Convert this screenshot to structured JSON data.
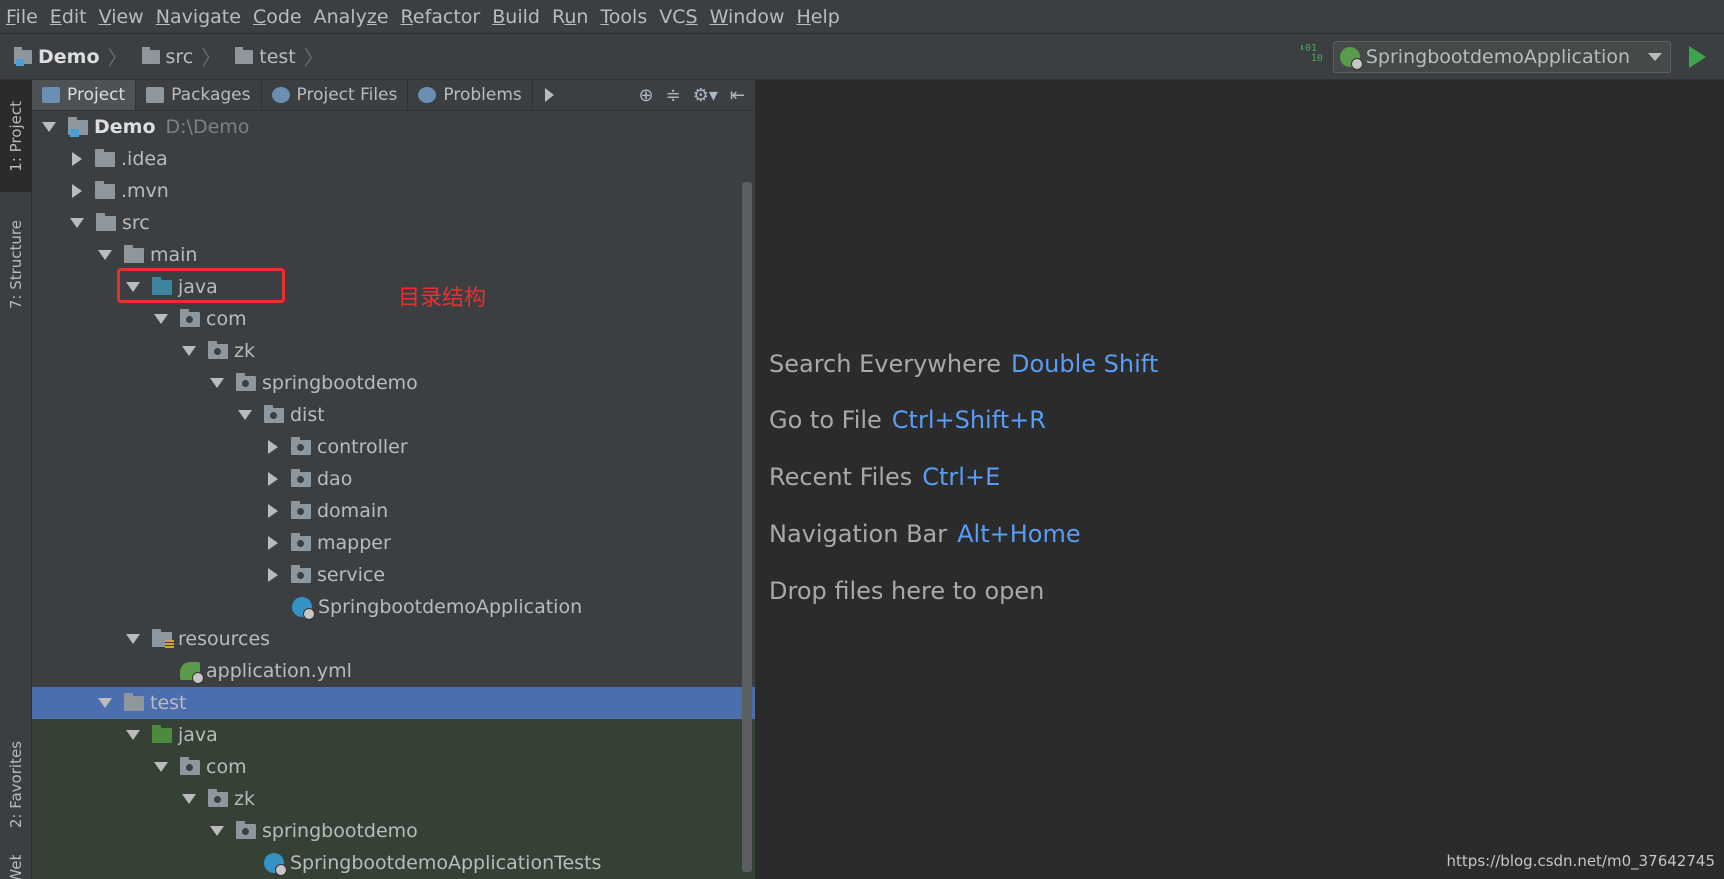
{
  "menubar": {
    "items": [
      {
        "mn": "F",
        "rest": "ile"
      },
      {
        "mn": "E",
        "rest": "dit"
      },
      {
        "mn": "V",
        "rest": "iew"
      },
      {
        "mn": "N",
        "rest": "avigate"
      },
      {
        "mn": "C",
        "rest": "ode"
      },
      {
        "pre": "Analy",
        "mn": "z",
        "rest": "e"
      },
      {
        "mn": "R",
        "rest": "efactor"
      },
      {
        "mn": "B",
        "rest": "uild"
      },
      {
        "pre": "R",
        "mn": "u",
        "rest": "n"
      },
      {
        "mn": "T",
        "rest": "ools"
      },
      {
        "pre": "VC",
        "mn": "S",
        "rest": ""
      },
      {
        "mn": "W",
        "rest": "indow"
      },
      {
        "mn": "H",
        "rest": "elp"
      }
    ]
  },
  "breadcrumb": [
    "Demo",
    "src",
    "test"
  ],
  "run_config": {
    "label": "SpringbootdemoApplication"
  },
  "side_tabs": {
    "project": "1: Project",
    "structure": "7: Structure",
    "favorites": "2: Favorites",
    "web": "Web"
  },
  "tool_tabs": [
    "Project",
    "Packages",
    "Project Files",
    "Problems"
  ],
  "tree": [
    {
      "label": "Demo",
      "hint": "D:\\Demo",
      "depth": 0,
      "expand": "down",
      "icon": "proj"
    },
    {
      "label": ".idea",
      "depth": 1,
      "expand": "right",
      "icon": "folder"
    },
    {
      "label": ".mvn",
      "depth": 1,
      "expand": "right",
      "icon": "folder"
    },
    {
      "label": "src",
      "depth": 1,
      "expand": "down",
      "icon": "folder"
    },
    {
      "label": "main",
      "depth": 2,
      "expand": "down",
      "icon": "folder"
    },
    {
      "label": "java",
      "depth": 3,
      "expand": "down",
      "icon": "src-folder"
    },
    {
      "label": "com",
      "depth": 4,
      "expand": "down",
      "icon": "package"
    },
    {
      "label": "zk",
      "depth": 5,
      "expand": "down",
      "icon": "package"
    },
    {
      "label": "springbootdemo",
      "depth": 6,
      "expand": "down",
      "icon": "package"
    },
    {
      "label": "dist",
      "depth": 7,
      "expand": "down",
      "icon": "package"
    },
    {
      "label": "controller",
      "depth": 8,
      "expand": "right",
      "icon": "package"
    },
    {
      "label": "dao",
      "depth": 8,
      "expand": "right",
      "icon": "package"
    },
    {
      "label": "domain",
      "depth": 8,
      "expand": "right",
      "icon": "package"
    },
    {
      "label": "mapper",
      "depth": 8,
      "expand": "right",
      "icon": "package"
    },
    {
      "label": "service",
      "depth": 8,
      "expand": "right",
      "icon": "package"
    },
    {
      "label": "SpringbootdemoApplication",
      "depth": 8,
      "expand": "none",
      "icon": "spring-class"
    },
    {
      "label": "resources",
      "depth": 3,
      "expand": "down",
      "icon": "resources"
    },
    {
      "label": "application.yml",
      "depth": 4,
      "expand": "none",
      "icon": "yml"
    },
    {
      "label": "test",
      "depth": 2,
      "expand": "down",
      "icon": "folder",
      "state": "selected"
    },
    {
      "label": "java",
      "depth": 3,
      "expand": "down",
      "icon": "test-folder",
      "state": "test"
    },
    {
      "label": "com",
      "depth": 4,
      "expand": "down",
      "icon": "package",
      "state": "test"
    },
    {
      "label": "zk",
      "depth": 5,
      "expand": "down",
      "icon": "package",
      "state": "test"
    },
    {
      "label": "springbootdemo",
      "depth": 6,
      "expand": "down",
      "icon": "package",
      "state": "test"
    },
    {
      "label": "SpringbootdemoApplicationTests",
      "depth": 7,
      "expand": "none",
      "icon": "class",
      "state": "test"
    }
  ],
  "annotation": "目录结构",
  "editor_hints": [
    {
      "text": "Search Everywhere",
      "key": "Double Shift"
    },
    {
      "text": "Go to File",
      "key": "Ctrl+Shift+R"
    },
    {
      "text": "Recent Files",
      "key": "Ctrl+E"
    },
    {
      "text": "Navigation Bar",
      "key": "Alt+Home"
    },
    {
      "text": "Drop files here to open",
      "key": ""
    }
  ],
  "watermark": "https://blog.csdn.net/m0_37642745",
  "colors": {
    "accent_link": "#589df6",
    "selection": "#4b6eaf",
    "annotation_red": "#e8302d",
    "test_bg": "#344134"
  }
}
